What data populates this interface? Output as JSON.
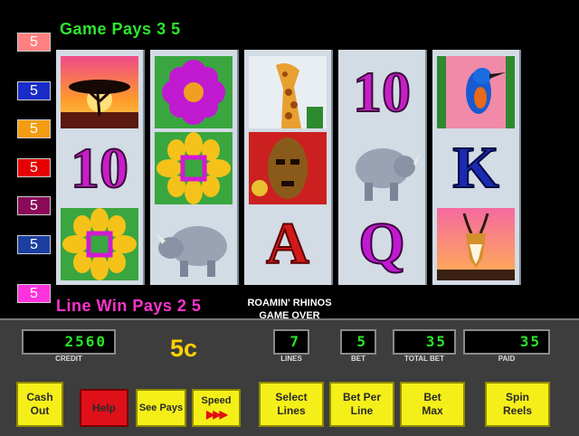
{
  "header": {
    "game_pays_text": "Game Pays 3 5"
  },
  "paylines": [
    {
      "label": "5",
      "color": "#ff8080",
      "text": "#fff"
    },
    {
      "label": "5",
      "color": "#1a2cc8",
      "text": "#fff"
    },
    {
      "label": "5",
      "color": "#f39c12",
      "text": "#fff"
    },
    {
      "label": "5",
      "color": "#e60000",
      "text": "#fff"
    },
    {
      "label": "5",
      "color": "#8b0a5a",
      "text": "#fff"
    },
    {
      "label": "5",
      "color": "#1c3ea0",
      "text": "#fff"
    },
    {
      "label": "5",
      "color": "#ff33dd",
      "text": "#fff"
    }
  ],
  "reels": [
    [
      "acacia-tree-icon",
      "flower-with-square-icon",
      "flower-with-square-icon"
    ],
    [
      "pink-flower-icon",
      "flower-with-square-icon",
      "rhino-icon"
    ],
    [
      "giraffe-icon",
      "tribal-mask-icon",
      "A"
    ],
    [
      "10",
      "rhino-icon",
      "Q"
    ],
    [
      "kingfisher-bird-icon",
      "K",
      "gazelle-icon"
    ]
  ],
  "reel_symbols_text": {
    "r1c2": "10",
    "r3c3": "A",
    "r4c1": "10",
    "r4c3": "Q",
    "r5c2": "K"
  },
  "line_win_text": "Line Win Pays 2 5",
  "status": {
    "line1": "ROAMIN' RHINOS",
    "line2": "GAME OVER"
  },
  "meters": {
    "credit": {
      "value": "2560",
      "label": "CREDIT"
    },
    "lines": {
      "value": "7",
      "label": "LINES"
    },
    "bet": {
      "value": "5",
      "label": "BET"
    },
    "total_bet": {
      "value": "35",
      "label": "TOTAL BET"
    },
    "paid": {
      "value": "35",
      "label": "PAID"
    }
  },
  "denomination": "5c",
  "buttons": {
    "cash_out": "Cash\nOut",
    "help": "Help",
    "see_pays": "See Pays",
    "speed": "Speed",
    "select_lines": "Select\nLines",
    "bet_per_line": "Bet Per\nLine",
    "bet_max": "Bet\nMax",
    "spin_reels": "Spin\nReels"
  },
  "colors": {
    "green_text": "#2ee62e",
    "pink_text": "#ff33cc",
    "button_yellow": "#f5ef19",
    "help_red": "#e0101a",
    "meter_green": "#27e827"
  }
}
